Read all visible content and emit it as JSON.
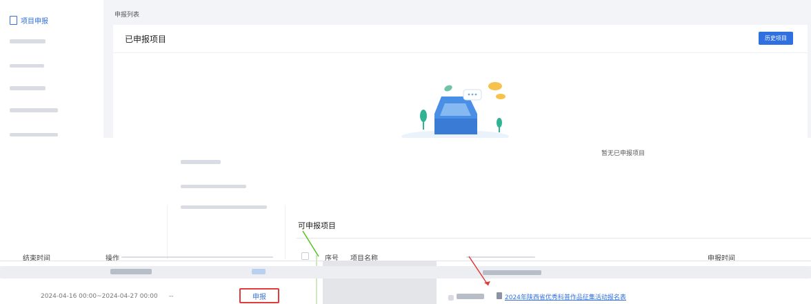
{
  "sidebar": {
    "items": [
      {
        "label": "项目申报",
        "icon": "document-icon"
      }
    ]
  },
  "breadcrumb": "申报列表",
  "declared": {
    "title": "已申报项目",
    "history_button": "历史项目",
    "empty_text": "暂无已申报项目"
  },
  "available": {
    "title": "可申报项目",
    "columns_left": [
      "结束时间",
      "操作"
    ],
    "columns_right": [
      "序号",
      "项目名称",
      "申报时间"
    ],
    "row": {
      "time_range": "2024-04-16 00:00~2024-04-27 00:00",
      "dash": "--",
      "action": "申报",
      "project_link": "2024年陕西省优秀科普作品征集活动报名表"
    }
  },
  "colors": {
    "accent": "#2f6fe0",
    "highlight_box": "#e03a3a",
    "arrow_red": "#e03a3a",
    "arrow_green": "#52c41a"
  }
}
